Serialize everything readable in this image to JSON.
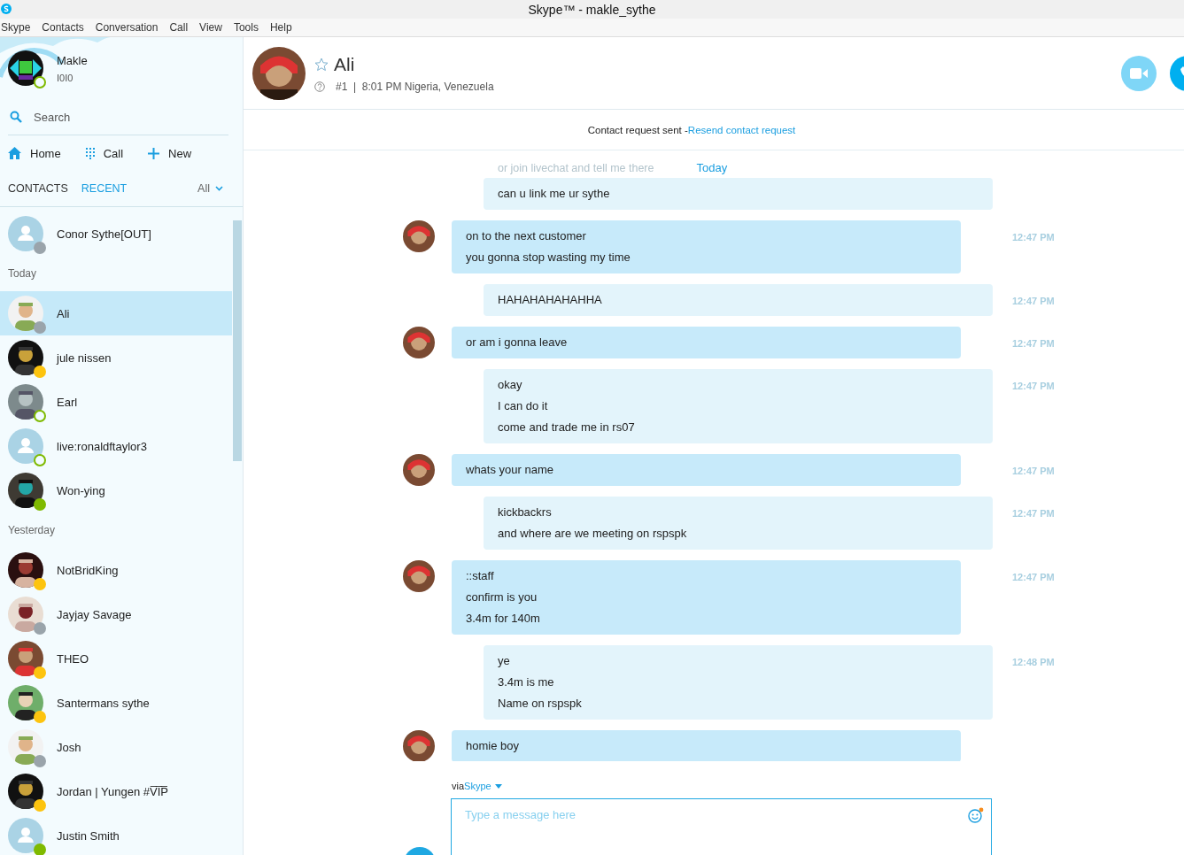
{
  "window": {
    "title": "Skype™ - makle_sythe"
  },
  "menu": [
    "Skype",
    "Contacts",
    "Conversation",
    "Call",
    "View",
    "Tools",
    "Help"
  ],
  "profile": {
    "name": "Makle",
    "mood": "I0I0",
    "status": {
      "kind": "online"
    }
  },
  "search": {
    "placeholder": "Search"
  },
  "nav": [
    {
      "kind": "home",
      "label": "Home"
    },
    {
      "kind": "dialpad",
      "label": "Call"
    },
    {
      "kind": "plus",
      "label": "New"
    }
  ],
  "tabs": [
    {
      "label": "CONTACTS",
      "selected": false
    },
    {
      "label": "RECENT",
      "selected": true
    }
  ],
  "filter": "All",
  "contacts": [
    {
      "kind": "row",
      "name": "Conor Sythe[OUT]",
      "avatar": {
        "kind": "default"
      },
      "status": {
        "kind": "unknown"
      },
      "selected": false
    },
    {
      "kind": "header",
      "name": "Today"
    },
    {
      "kind": "row",
      "name": "Ali",
      "status": {
        "kind": "unknown"
      },
      "selected": true
    },
    {
      "kind": "row",
      "name": "jule nissen",
      "status": {
        "kind": "away"
      },
      "selected": false
    },
    {
      "kind": "row",
      "name": "Earl",
      "status": {
        "kind": "online"
      },
      "selected": false
    },
    {
      "kind": "row",
      "name": "live:ronaldftaylor3",
      "avatar": {
        "kind": "default"
      },
      "status": {
        "kind": "online"
      },
      "selected": false
    },
    {
      "kind": "row",
      "name": "Won-ying",
      "status": {
        "kind": "available"
      },
      "selected": false
    },
    {
      "kind": "header",
      "name": "Yesterday"
    },
    {
      "kind": "row",
      "name": "NotBridKing",
      "status": {
        "kind": "away"
      },
      "selected": false
    },
    {
      "kind": "row",
      "name": "Jayjay Savage",
      "status": {
        "kind": "unknown"
      },
      "selected": false
    },
    {
      "kind": "row",
      "name": "THEO",
      "status": {
        "kind": "away"
      },
      "selected": false
    },
    {
      "kind": "row",
      "name": "Santermans sythe",
      "status": {
        "kind": "away"
      },
      "selected": false
    },
    {
      "kind": "row",
      "name": "Josh",
      "status": {
        "kind": "unknown"
      },
      "selected": false
    },
    {
      "kind": "row",
      "name": "Jordan | Yungen #V̅I̅P̅",
      "status": {
        "kind": "away"
      },
      "selected": false
    },
    {
      "kind": "row",
      "name": "Justin Smith",
      "avatar": {
        "kind": "default"
      },
      "status": {
        "kind": "available"
      },
      "selected": false
    }
  ],
  "conversation": {
    "name": "Ali",
    "info": "#1  |  8:01 PM Nigeria, Venezuela",
    "notice": "Contact request sent - ",
    "notice_link": "Resend contact request",
    "faded_line": "or join livechat and tell me there",
    "day": "Today",
    "messages": [
      {
        "kind": "outgoing",
        "lines": [
          "can u link me ur sythe"
        ]
      },
      {
        "kind": "incoming",
        "lines": [
          "on to the next customer",
          "you gonna stop wasting my time"
        ],
        "time": "12:47 PM"
      },
      {
        "kind": "outgoing",
        "lines": [
          "HAHAHAHAHAHHA"
        ],
        "time": "12:47 PM"
      },
      {
        "kind": "incoming",
        "lines": [
          "or am i gonna leave"
        ],
        "time": "12:47 PM"
      },
      {
        "kind": "outgoing",
        "lines": [
          "okay",
          "I can do it",
          "come and trade me in rs07"
        ],
        "time": "12:47 PM"
      },
      {
        "kind": "incoming",
        "lines": [
          "whats your name"
        ],
        "time": "12:47 PM"
      },
      {
        "kind": "outgoing",
        "lines": [
          "kickbackrs",
          "and where are we meeting on rspspk"
        ],
        "time": "12:47 PM"
      },
      {
        "kind": "incoming",
        "lines": [
          "::staff",
          "confirm is you",
          "3.4m for 140m"
        ],
        "time": "12:47 PM"
      },
      {
        "kind": "outgoing",
        "lines": [
          "ye",
          "3.4m is me",
          "Name on rspspk"
        ],
        "time": "12:48 PM"
      },
      {
        "kind": "incoming",
        "lines": [
          "homie boy"
        ]
      }
    ],
    "via": "via ",
    "via_link": "Skype",
    "input": {
      "placeholder": "Type a message here"
    }
  }
}
